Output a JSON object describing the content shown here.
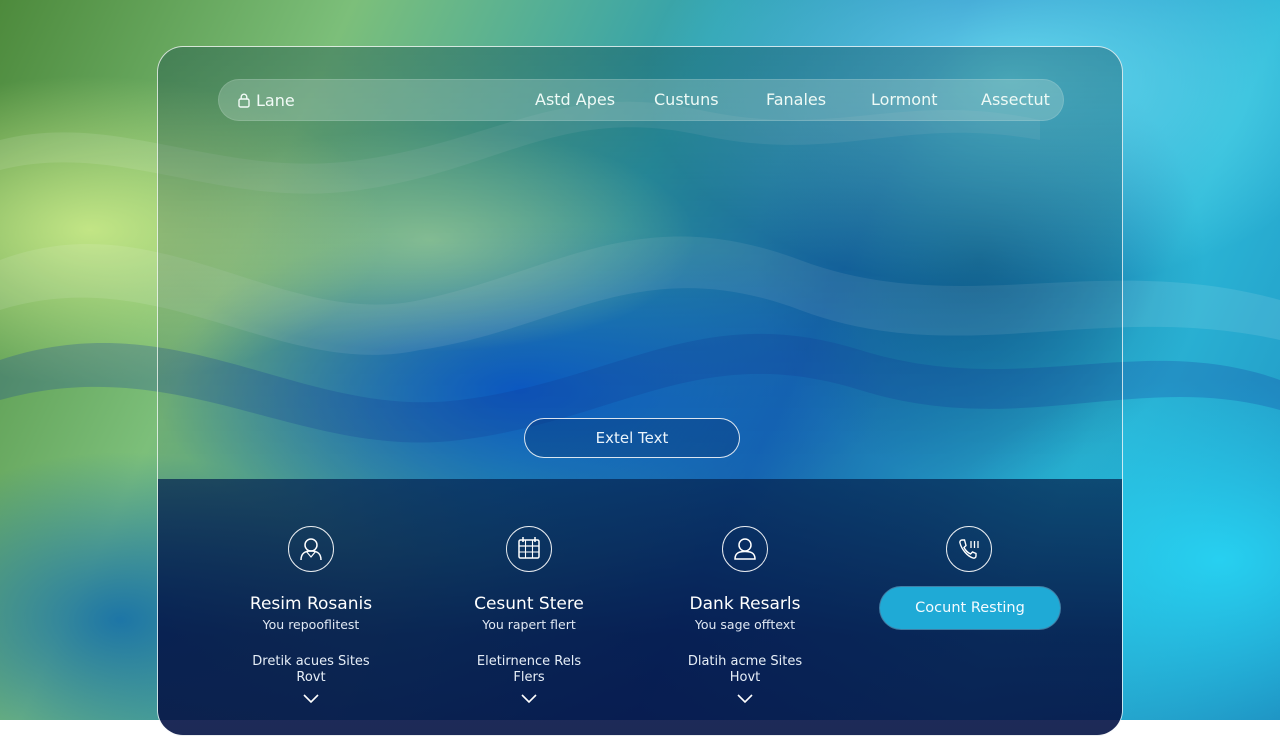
{
  "navbar": {
    "brand": "Lane",
    "items": [
      {
        "label": "Astd Apes"
      },
      {
        "label": "Custuns"
      },
      {
        "label": "Fanales"
      },
      {
        "label": "Lormont"
      },
      {
        "label": "Assectut"
      }
    ]
  },
  "hero": {
    "button_label": "Extel Text"
  },
  "features": [
    {
      "icon": "person-icon",
      "title": "Resim Rosanis",
      "subtitle": "You repooflitest",
      "desc_line1": "Dretik acues Sites",
      "desc_line2": "Rovt"
    },
    {
      "icon": "calendar-grid-icon",
      "title": "Cesunt Stere",
      "subtitle": "You rapert flert",
      "desc_line1": "Eletirnence Rels",
      "desc_line2": "Flers"
    },
    {
      "icon": "person-icon",
      "title": "Dank Resarls",
      "subtitle": "You sage offtext",
      "desc_line1": "Dlatih acme Sites",
      "desc_line2": "Hovt"
    }
  ],
  "cta": {
    "icon": "phone-icon",
    "label": "Cocunt Resting",
    "color": "#1faad6"
  },
  "colors": {
    "panel_border": "#ffffff",
    "bottom_bg": "#06205a"
  }
}
